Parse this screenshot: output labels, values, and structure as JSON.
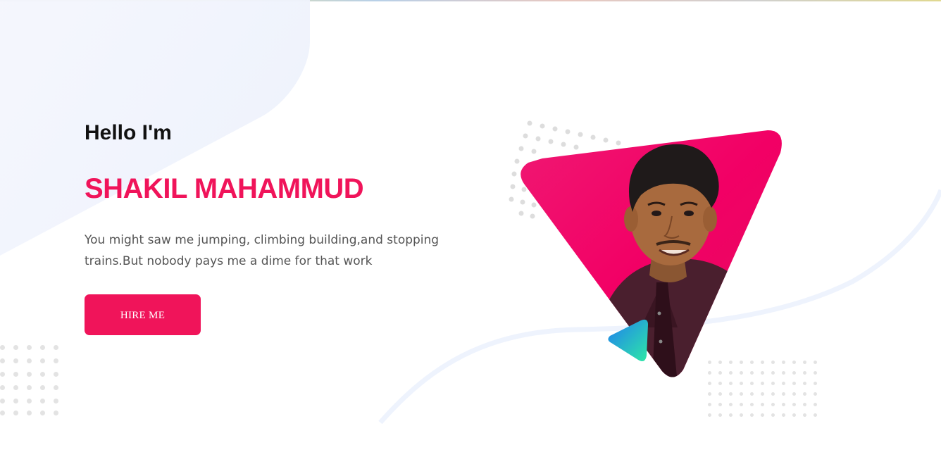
{
  "hero": {
    "greeting": "Hello I'm",
    "name": "SHAKIL MAHAMMUD",
    "bio": "You might saw me jumping, climbing building,and stopping trains.But nobody pays me a dime for that work",
    "cta_label": "HIRE ME"
  },
  "colors": {
    "accent": "#f0145a",
    "shape_green": "#2ee8a6",
    "shape_blue": "#1f7ef0"
  },
  "icons": {
    "portrait": "person-portrait-icon",
    "play_triangle": "play-triangle-icon"
  }
}
